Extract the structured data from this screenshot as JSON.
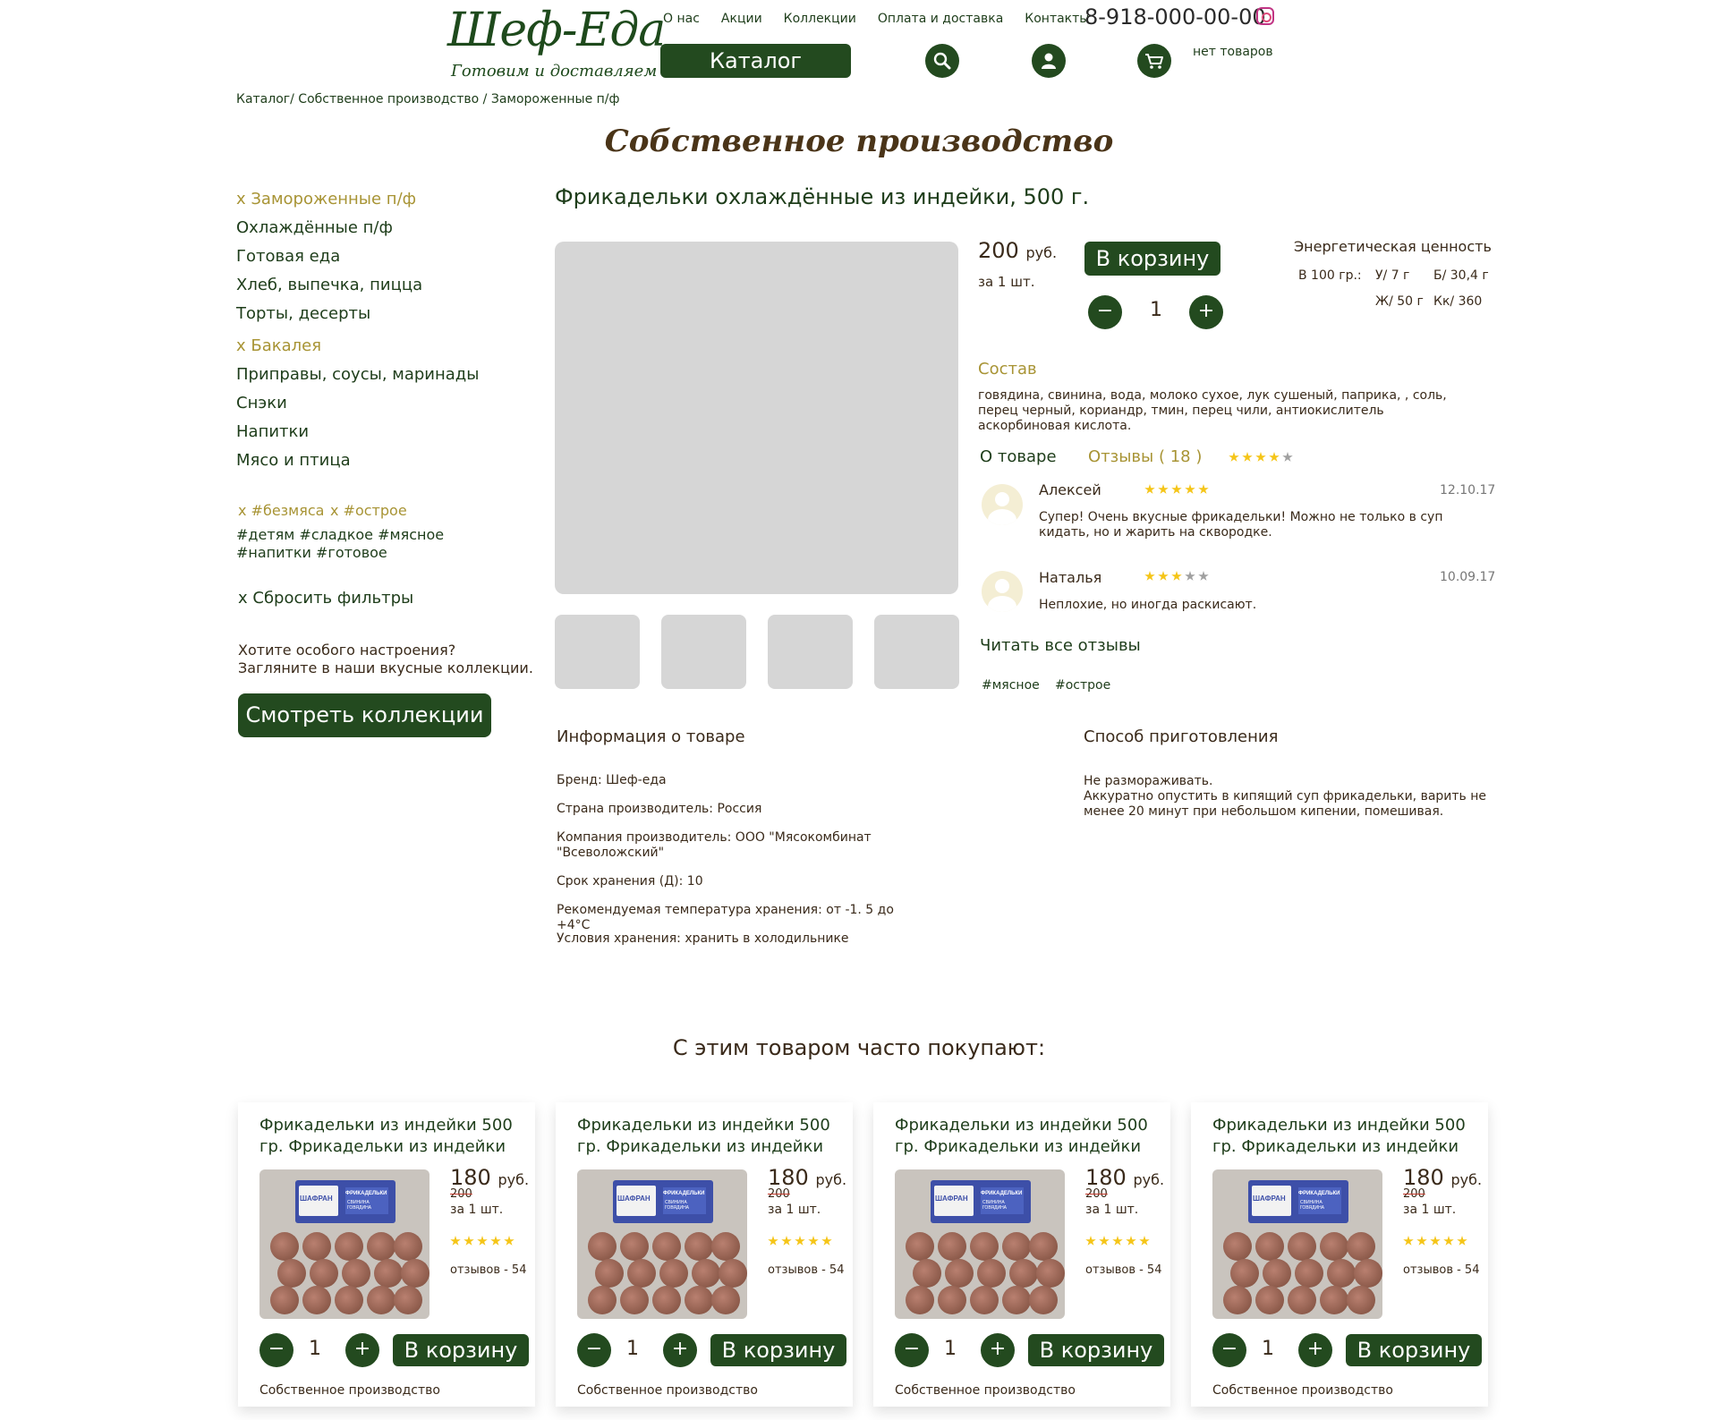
{
  "header": {
    "logo_title": "Шеф-Еда",
    "logo_subtitle": "Готовим и доставляем",
    "nav": [
      "О нас",
      "Акции",
      "Коллекции",
      "Оплата и доставка",
      "Контакты"
    ],
    "phone": "8-918-000-00-00",
    "catalog_label": "Каталог",
    "cart_status": "нет товаров",
    "icons": [
      "search-icon",
      "user-icon",
      "cart-icon",
      "instagram-icon"
    ]
  },
  "breadcrumb": "Каталог/ Собственное производство / Замороженные п/ф",
  "section_title": "Собственное производство",
  "sidebar": {
    "categories": [
      {
        "label": "x Замороженные п/ф",
        "active": true
      },
      {
        "label": "Охлаждённые п/ф",
        "active": false
      },
      {
        "label": "Готовая еда",
        "active": false
      },
      {
        "label": "Хлеб, выпечка, пицца",
        "active": false
      },
      {
        "label": "Торты, десерты",
        "active": false
      },
      {
        "label": "x Бакалея",
        "active": true
      },
      {
        "label": "Приправы, соусы, маринады",
        "active": false
      },
      {
        "label": "Снэки",
        "active": false
      },
      {
        "label": "Напитки",
        "active": false
      },
      {
        "label": "Мясо и птица",
        "active": false
      }
    ],
    "active_tags": [
      "x #безмяса",
      "x #острое"
    ],
    "tags": "#детям #сладкое #мясное #напитки #готовое",
    "reset_label": "x Сбросить фильтры",
    "promo_text": "Хотите особого настроения? Загляните в наши вкусные коллекции.",
    "collections_button": "Смотреть коллекции"
  },
  "product": {
    "title": "Фрикадельки охлаждённые из индейки, 500 г.",
    "price": "200",
    "currency": "руб.",
    "per_unit": "за 1 шт.",
    "cart_button": "В корзину",
    "quantity": "1",
    "minus": "−",
    "plus": "+",
    "energy": {
      "title": "Энергетическая ценность",
      "per": "В 100 гр.:",
      "carbs": "У/ 7 г",
      "protein": "Б/ 30,4 г",
      "fat": "Ж/ 50 г",
      "kcal": "Кк/ 360"
    },
    "composition_title": "Состав",
    "composition": "говядина, свинина, вода, молоко сухое, лук сушеный, паприка, , соль, перец черный, кориандр, тмин, перец чили, антиокислитель аскорбиновая кислота.",
    "tab_about": "О товаре",
    "tab_reviews": "Отзывы ( 18 )",
    "rating": 4,
    "reviews": [
      {
        "name": "Алексей",
        "rating": 5,
        "date": "12.10.17",
        "text": "Супер! Очень вкусные фрикадельки! Можно не только в суп кидать, но и жарить на сквородке."
      },
      {
        "name": "Наталья",
        "rating": 3,
        "date": "10.09.17",
        "text": "Неплохие, но иногда раскисают."
      }
    ],
    "read_all": "Читать все отзывы",
    "tags": [
      "#мясное",
      "#острое"
    ],
    "info_title": "Информация о товаре",
    "info": [
      "Бренд: Шеф-еда",
      "Страна производитель: Россия",
      "Компания производитель: ООО \"Мясокомбинат \"Всеволожский\"",
      "Срок хранения (Д): 10",
      "Рекомендуемая температура хранения: от -1. 5 до +4°С",
      "Условия хранения: хранить в холодильнике"
    ],
    "cooking_title": "Способ приготовления",
    "cooking_line1": "Не размораживать.",
    "cooking_line2": "Аккуратно опустить в кипящий суп фрикадельки, варить не менее 20 минут при небольшом кипении, помешивая."
  },
  "also_bought": {
    "title": "С этим товаром часто покупают:",
    "cards": [
      {
        "title": "Фрикадельки из индейки 500 гр. Фрикадельки из индейки",
        "price": "180",
        "currency": "руб.",
        "old_price": "200",
        "per_unit": "за 1 шт.",
        "rating": 5,
        "reviews": "отзывов - 54",
        "quantity": "1",
        "cart": "В корзину",
        "category": "Собственное производство",
        "pack_brand": "ШАФРАН",
        "pack_name": "ФРИКАДЕЛЬКИ",
        "pack_sub": "СВИНИНА ГОВЯДИНА"
      },
      {
        "title": "Фрикадельки из индейки 500 гр. Фрикадельки из индейки",
        "price": "180",
        "currency": "руб.",
        "old_price": "200",
        "per_unit": "за 1 шт.",
        "rating": 5,
        "reviews": "отзывов - 54",
        "quantity": "1",
        "cart": "В корзину",
        "category": "Собственное производство",
        "pack_brand": "ШАФРАН",
        "pack_name": "ФРИКАДЕЛЬКИ",
        "pack_sub": "СВИНИНА ГОВЯДИНА"
      },
      {
        "title": "Фрикадельки из индейки 500 гр. Фрикадельки из индейки",
        "price": "180",
        "currency": "руб.",
        "old_price": "200",
        "per_unit": "за 1 шт.",
        "rating": 5,
        "reviews": "отзывов - 54",
        "quantity": "1",
        "cart": "В корзину",
        "category": "Собственное производство",
        "pack_brand": "ШАФРАН",
        "pack_name": "ФРИКАДЕЛЬКИ",
        "pack_sub": "СВИНИНА ГОВЯДИНА"
      },
      {
        "title": "Фрикадельки из индейки 500 гр. Фрикадельки из индейки",
        "price": "180",
        "currency": "руб.",
        "old_price": "200",
        "per_unit": "за 1 шт.",
        "rating": 5,
        "reviews": "отзывов - 54",
        "quantity": "1",
        "cart": "В корзину",
        "category": "Собственное производство",
        "pack_brand": "ШАФРАН",
        "pack_name": "ФРИКАДЕЛЬКИ",
        "pack_sub": "СВИНИНА ГОВЯДИНА"
      }
    ]
  },
  "colors": {
    "brand_green": "#234a1f",
    "accent_gold": "#a89435",
    "star": "#f5c518"
  }
}
